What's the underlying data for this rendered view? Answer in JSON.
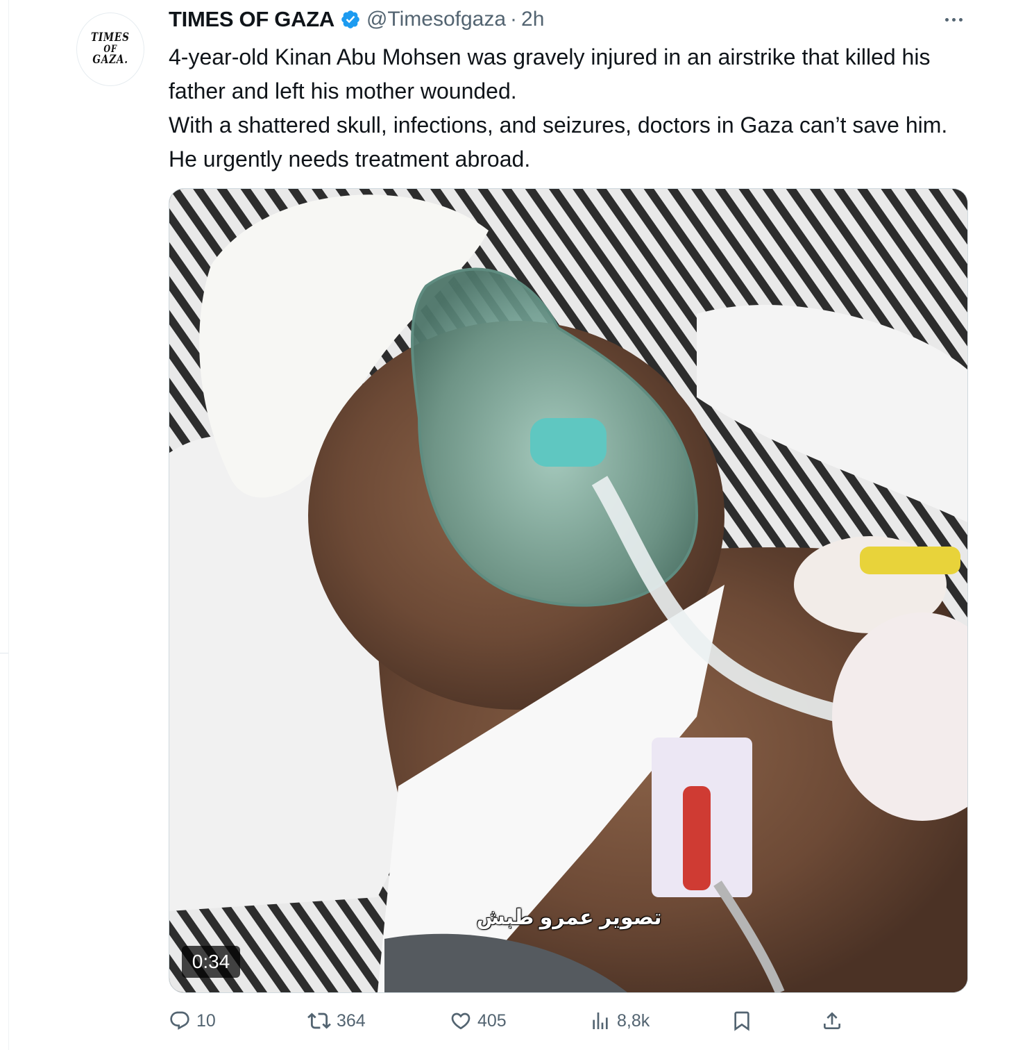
{
  "tweet": {
    "author_name": "TIMES OF GAZA",
    "handle": "@Timesofgaza",
    "separator": "·",
    "timestamp": "2h",
    "verified": true,
    "avatar_text": [
      "TIMES",
      "OF",
      "GAZA."
    ],
    "text_lines": [
      "4-year-old Kinan Abu Mohsen was gravely injured in an airstrike that killed his father and left his mother wounded.",
      "With a shattered skull, infections, and seizures, doctors in Gaza can’t save him. He urgently needs treatment abroad."
    ]
  },
  "media": {
    "type": "video",
    "duration": "0:34",
    "caption_overlay": "تصوير عمرو طبش"
  },
  "actions": {
    "replies": "10",
    "reposts": "364",
    "likes": "405",
    "views": "8,8k"
  },
  "icons": {
    "reply": "reply-icon",
    "repost": "repost-icon",
    "like": "heart-icon",
    "views": "views-icon",
    "bookmark": "bookmark-icon",
    "share": "share-icon",
    "more": "more-icon",
    "verified": "verified-badge-icon"
  },
  "colors": {
    "text_primary": "#0f1419",
    "text_secondary": "#536471",
    "verified_blue": "#1d9bf0",
    "border": "#cfd9de"
  }
}
